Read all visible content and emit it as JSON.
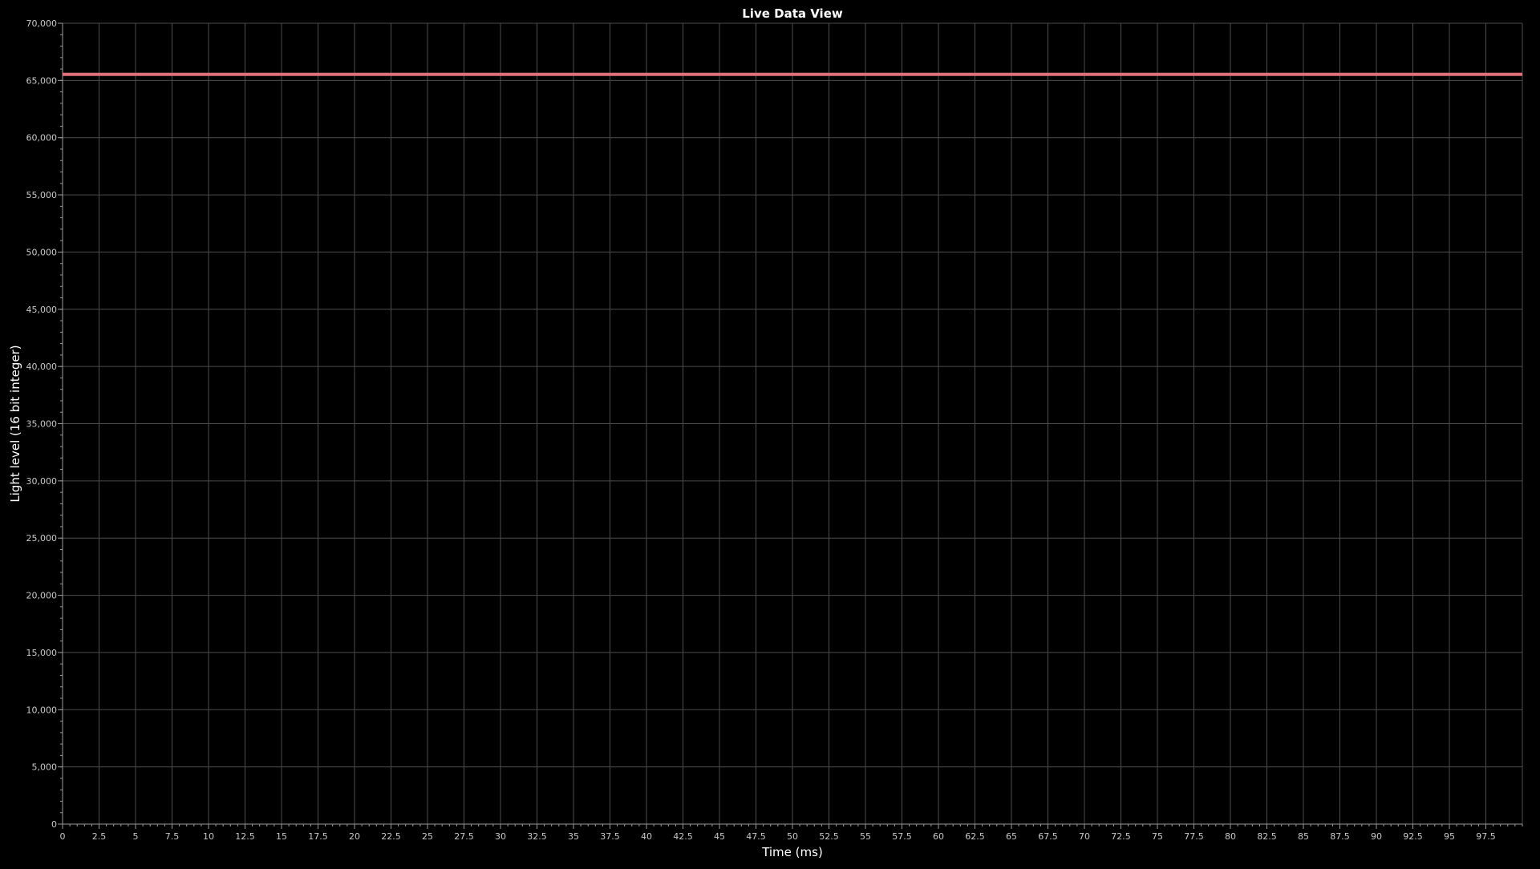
{
  "window": {
    "title": "Live Data View"
  },
  "colors": {
    "background": "#000000",
    "grid_major": "#4d4d4d",
    "grid_minor": "#2a2a2a",
    "axis": "#9a9a9a",
    "tick_label": "#c8c8c8",
    "title": "#ffffff",
    "axis_label": "#ffffff",
    "series": "#e0707a"
  },
  "chart_data": {
    "type": "line",
    "title": "Live Data View",
    "xlabel": "Time (ms)",
    "ylabel": "Light level (16 bit integer)",
    "xlim": [
      0,
      100
    ],
    "ylim": [
      0,
      70000
    ],
    "x_major_step": 2.5,
    "x_minor_step": 0.5,
    "y_major_step": 5000,
    "y_minor_step": 1000,
    "x_ticks": [
      "0",
      "2.5",
      "5",
      "7.5",
      "10",
      "12.5",
      "15",
      "17.5",
      "20",
      "22.5",
      "25",
      "27.5",
      "30",
      "32.5",
      "35",
      "37.5",
      "40",
      "42.5",
      "45",
      "47.5",
      "50",
      "52.5",
      "55",
      "57.5",
      "60",
      "62.5",
      "65",
      "67.5",
      "70",
      "72.5",
      "75",
      "77.5",
      "80",
      "82.5",
      "85",
      "87.5",
      "90",
      "92.5",
      "95",
      "97.5"
    ],
    "y_ticks": [
      "0",
      "5,000",
      "10,000",
      "15,000",
      "20,000",
      "25,000",
      "30,000",
      "35,000",
      "40,000",
      "45,000",
      "50,000",
      "55,000",
      "60,000",
      "65,000",
      "70,000"
    ],
    "grid": true,
    "series": [
      {
        "x": [
          0,
          100
        ],
        "values": [
          65535,
          65535
        ]
      }
    ]
  }
}
